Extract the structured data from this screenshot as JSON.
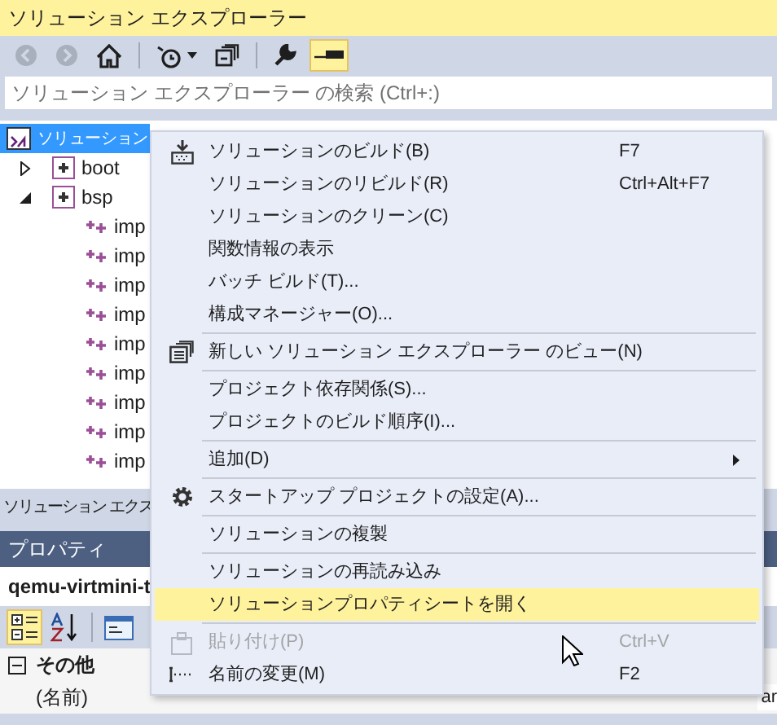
{
  "explorer": {
    "title": "ソリューション エクスプローラー",
    "toolbar": [
      {
        "kind": "button",
        "disabled": true,
        "selected": false
      },
      {
        "kind": "button",
        "disabled": true,
        "selected": false
      },
      {
        "kind": "button",
        "disabled": false,
        "selected": false
      },
      {
        "kind": "separator"
      },
      {
        "kind": "dropdown",
        "disabled": false,
        "selected": false
      },
      {
        "kind": "button",
        "disabled": false,
        "selected": false
      },
      {
        "kind": "separator"
      },
      {
        "kind": "button",
        "disabled": false,
        "selected": false
      },
      {
        "kind": "button",
        "disabled": false,
        "selected": true
      }
    ],
    "search": {
      "placeholder": "ソリューション エクスプローラー の検索 (Ctrl+:)"
    },
    "tree": [
      {
        "label": "ソリューション",
        "selected": true,
        "children": [
          {
            "label": "boot",
            "expanded": false,
            "selected": false
          },
          {
            "label": "bsp",
            "expanded": true,
            "selected": false,
            "children": [
              {
                "label": "imp",
                "selected": false
              },
              {
                "label": "imp",
                "selected": false
              },
              {
                "label": "imp",
                "selected": false
              },
              {
                "label": "imp",
                "selected": false
              },
              {
                "label": "imp",
                "selected": false
              },
              {
                "label": "imp",
                "selected": false
              },
              {
                "label": "imp",
                "selected": false
              },
              {
                "label": "imp",
                "selected": false
              },
              {
                "label": "imp",
                "selected": false
              }
            ]
          }
        ]
      }
    ],
    "tab": "ソリューション エクス"
  },
  "properties": {
    "title": "プロパティ",
    "object": "qemu-virtmini-t",
    "toolbar": [
      {
        "kind": "button",
        "selected": true
      },
      {
        "kind": "button",
        "selected": false
      },
      {
        "kind": "separator"
      },
      {
        "kind": "button",
        "selected": false
      }
    ],
    "category": {
      "label": "その他",
      "expanded": true
    },
    "rows": [
      {
        "name": "(名前)",
        "value": "ar"
      }
    ]
  },
  "context_menu": [
    {
      "kind": "item",
      "label": "ソリューションのビルド(B)",
      "shortcut": "F7",
      "selected": false,
      "disabled": false
    },
    {
      "kind": "item",
      "label": "ソリューションのリビルド(R)",
      "shortcut": "Ctrl+Alt+F7",
      "selected": false,
      "disabled": false
    },
    {
      "kind": "item",
      "label": "ソリューションのクリーン(C)",
      "selected": false,
      "disabled": false
    },
    {
      "kind": "item",
      "label": "関数情報の表示",
      "selected": false,
      "disabled": false
    },
    {
      "kind": "item",
      "label": "バッチ ビルド(T)...",
      "selected": false,
      "disabled": false
    },
    {
      "kind": "item",
      "label": "構成マネージャー(O)...",
      "selected": false,
      "disabled": false
    },
    {
      "kind": "separator"
    },
    {
      "kind": "item",
      "label": "新しい ソリューション エクスプローラー のビュー(N)",
      "selected": false,
      "disabled": false
    },
    {
      "kind": "separator"
    },
    {
      "kind": "item",
      "label": "プロジェクト依存関係(S)...",
      "selected": false,
      "disabled": false
    },
    {
      "kind": "item",
      "label": "プロジェクトのビルド順序(I)...",
      "selected": false,
      "disabled": false
    },
    {
      "kind": "separator"
    },
    {
      "kind": "submenu",
      "label": "追加(D)",
      "selected": false,
      "disabled": false
    },
    {
      "kind": "separator"
    },
    {
      "kind": "item",
      "label": "スタートアップ プロジェクトの設定(A)...",
      "selected": false,
      "disabled": false
    },
    {
      "kind": "separator"
    },
    {
      "kind": "item",
      "label": "ソリューションの複製",
      "selected": false,
      "disabled": false
    },
    {
      "kind": "separator"
    },
    {
      "kind": "item",
      "label": "ソリューションの再読み込み",
      "selected": false,
      "disabled": false
    },
    {
      "kind": "item",
      "label": "ソリューションプロパティシートを開く",
      "selected": true,
      "disabled": false
    },
    {
      "kind": "separator"
    },
    {
      "kind": "item",
      "label": "貼り付け(P)",
      "shortcut": "Ctrl+V",
      "selected": false,
      "disabled": true
    },
    {
      "kind": "item",
      "label": "名前の変更(M)",
      "shortcut": "F2",
      "selected": false,
      "disabled": false
    }
  ]
}
